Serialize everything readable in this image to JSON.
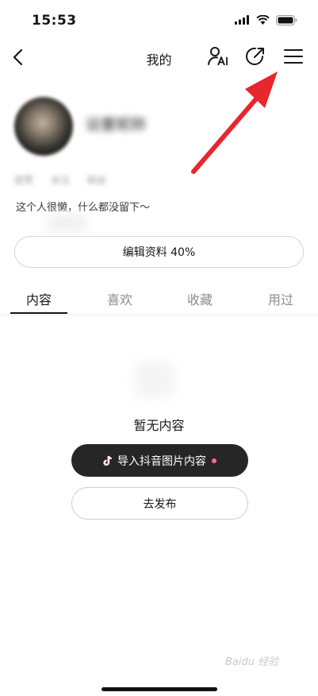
{
  "status_bar": {
    "time": "15:53",
    "icons": [
      "cellular-signal-icon",
      "wifi-icon",
      "battery-icon"
    ]
  },
  "nav": {
    "title": "我的",
    "icons": [
      "back-arrow-icon",
      "person-ai-icon",
      "share-arrow-icon",
      "hamburger-menu-icon"
    ]
  },
  "profile": {
    "nickname": "设置昵称",
    "stats": [
      "获赞",
      "关注",
      "粉丝"
    ],
    "bio": "这个人很懒，什么都没留下～",
    "edit_button": "编辑资料 40%"
  },
  "tabs": [
    {
      "label": "内容",
      "active": true
    },
    {
      "label": "喜欢",
      "active": false
    },
    {
      "label": "收藏",
      "active": false
    },
    {
      "label": "用过",
      "active": false
    }
  ],
  "empty_state": {
    "text": "暂无内容",
    "import_button": "导入抖音图片内容",
    "publish_button": "去发布"
  },
  "colors": {
    "annotation_arrow": "#e8262d",
    "dark_button": "#262626",
    "dot": "#ff6b8b"
  },
  "watermark": "Baidu 经验"
}
